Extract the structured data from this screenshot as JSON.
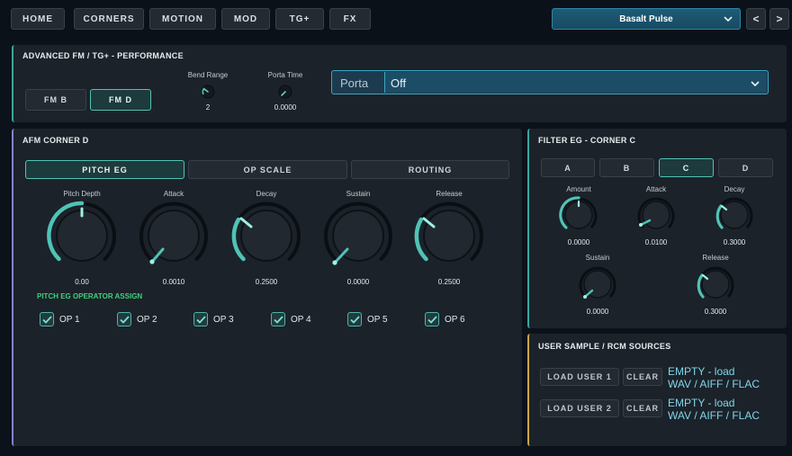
{
  "tabs": [
    {
      "label": "HOME"
    },
    {
      "label": "CORNERS"
    },
    {
      "label": "MOTION"
    },
    {
      "label": "MOD"
    },
    {
      "label": "TG+"
    },
    {
      "label": "FX"
    }
  ],
  "preset": {
    "name": "Basalt Pulse",
    "prev_label": "<",
    "next_label": ">"
  },
  "performance": {
    "title": "ADVANCED FM / TG+ - PERFORMANCE",
    "fm_buttons": [
      {
        "label": "FM B",
        "active": false
      },
      {
        "label": "FM D",
        "active": true
      }
    ],
    "bend_range": {
      "label": "Bend Range",
      "value": "2"
    },
    "porta_time": {
      "label": "Porta Time",
      "value": "0.0000"
    },
    "porta": {
      "label": "Porta",
      "value": "Off"
    }
  },
  "afm": {
    "title": "AFM CORNER D",
    "tabs": [
      {
        "label": "PITCH EG",
        "active": true
      },
      {
        "label": "OP SCALE",
        "active": false
      },
      {
        "label": "ROUTING",
        "active": false
      }
    ],
    "knobs": [
      {
        "label": "Pitch Depth",
        "value": "0.00"
      },
      {
        "label": "Attack",
        "value": "0.0010"
      },
      {
        "label": "Decay",
        "value": "0.2500"
      },
      {
        "label": "Sustain",
        "value": "0.0000"
      },
      {
        "label": "Release",
        "value": "0.2500"
      }
    ],
    "assign_title": "PITCH EG OPERATOR ASSIGN",
    "operators": [
      {
        "label": "OP 1",
        "checked": true
      },
      {
        "label": "OP 2",
        "checked": true
      },
      {
        "label": "OP 3",
        "checked": true
      },
      {
        "label": "OP 4",
        "checked": true
      },
      {
        "label": "OP 5",
        "checked": true
      },
      {
        "label": "OP 6",
        "checked": true
      }
    ]
  },
  "filter_eg": {
    "title": "FILTER EG - CORNER C",
    "corners": [
      {
        "label": "A",
        "active": false
      },
      {
        "label": "B",
        "active": false
      },
      {
        "label": "C",
        "active": true
      },
      {
        "label": "D",
        "active": false
      }
    ],
    "knobs": [
      {
        "label": "Amount",
        "value": "0.0000"
      },
      {
        "label": "Attack",
        "value": "0.0100"
      },
      {
        "label": "Decay",
        "value": "0.3000"
      },
      {
        "label": "Sustain",
        "value": "0.0000"
      },
      {
        "label": "Release",
        "value": "0.3000"
      }
    ]
  },
  "sources": {
    "title": "USER SAMPLE / RCM SOURCES",
    "rows": [
      {
        "load_label": "LOAD USER 1",
        "clear_label": "CLEAR",
        "status_line1": "EMPTY - load",
        "status_line2": "WAV / AIFF / FLAC"
      },
      {
        "load_label": "LOAD USER 2",
        "clear_label": "CLEAR",
        "status_line1": "EMPTY - load",
        "status_line2": "WAV / AIFF / FLAC"
      }
    ]
  },
  "colors": {
    "accent": "#4fc3b6",
    "preset": "#1f5a74",
    "label_green": "#3ed07f",
    "status_cyan": "#7fd7ea"
  }
}
